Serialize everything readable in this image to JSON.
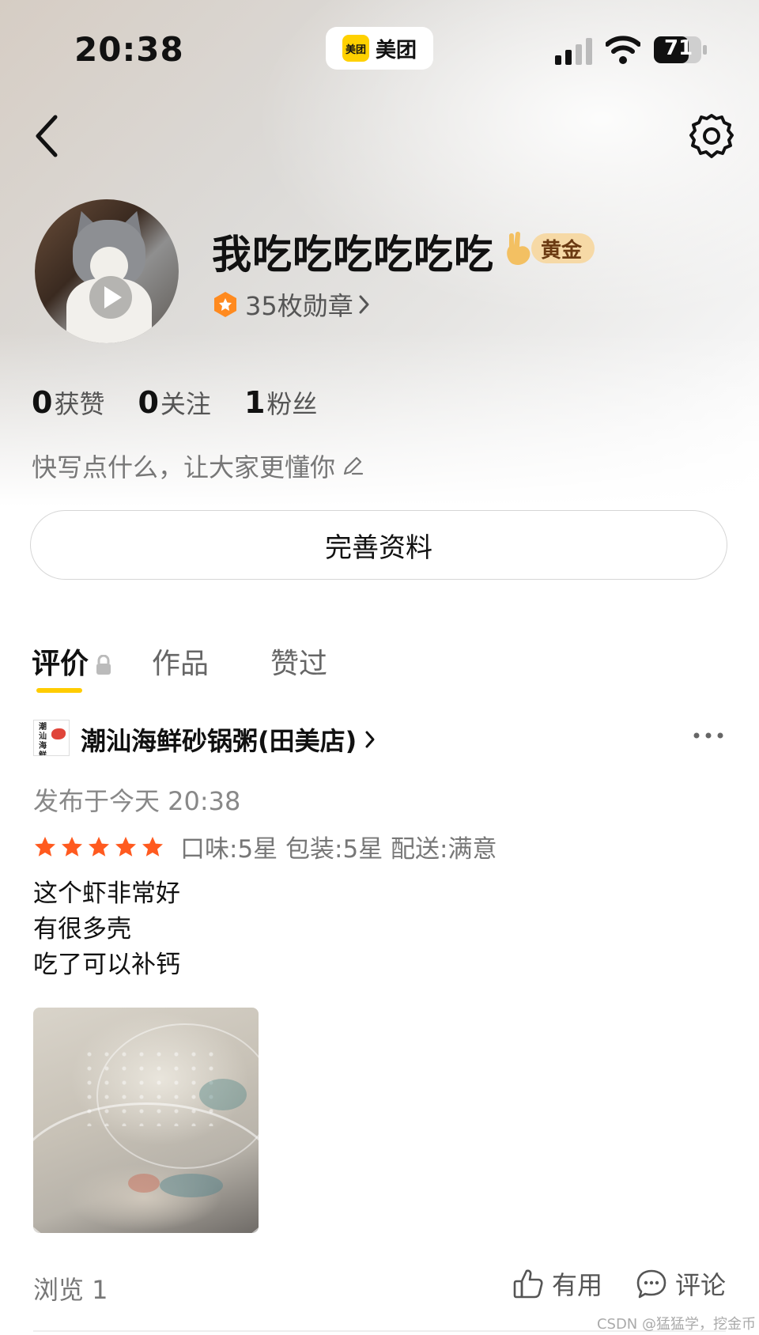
{
  "status_bar": {
    "time": "20:38",
    "app_logo_text": "美团",
    "app_name": "美团",
    "battery_level": "71"
  },
  "profile": {
    "nickname": "我吃吃吃吃吃吃",
    "level": "黄金",
    "medals": "35枚勋章",
    "stats": [
      {
        "num": "0",
        "label": "获赞"
      },
      {
        "num": "0",
        "label": "关注"
      },
      {
        "num": "1",
        "label": "粉丝"
      }
    ],
    "bio_placeholder": "快写点什么，让大家更懂你",
    "edit_button": "完善资料"
  },
  "tabs": [
    {
      "label": "评价",
      "active": true
    },
    {
      "label": "作品",
      "active": false
    },
    {
      "label": "赞过",
      "active": false
    }
  ],
  "review": {
    "shop_logo_text": "潮汕海鲜砂锅粥",
    "shop_name": "潮汕海鲜砂锅粥(田美店)",
    "published": "发布于今天 20:38",
    "stars": 5,
    "ratings_text": "口味:5星  包装:5星  配送:满意",
    "text_lines": [
      "这个虾非常好",
      "有很多壳",
      "吃了可以补钙"
    ],
    "views": "浏览 1",
    "useful_label": "有用",
    "comment_label": "评论"
  },
  "colors": {
    "accent_yellow": "#ffcc00",
    "star_orange": "#ff5a1f",
    "level_badge_bg": "#f6d9a6"
  },
  "watermark": "CSDN @猛猛学，挖金币"
}
